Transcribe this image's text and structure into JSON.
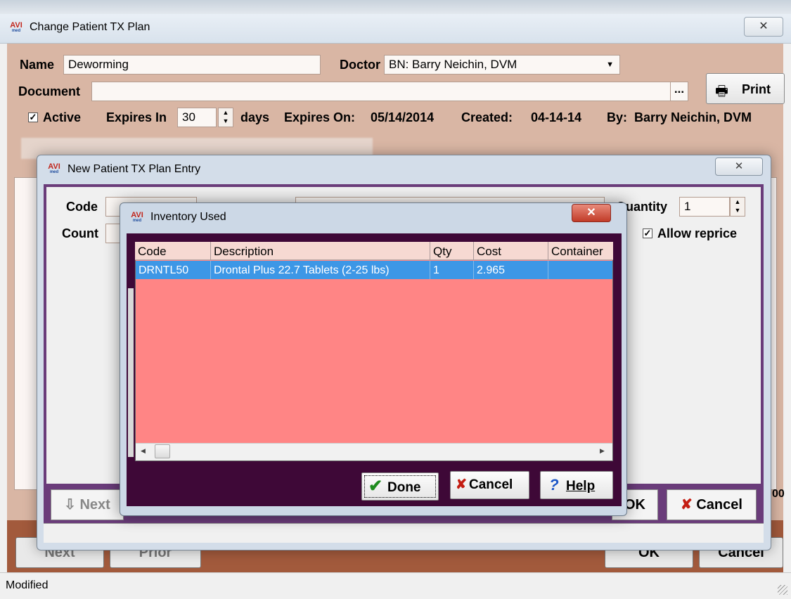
{
  "main": {
    "title": "Change Patient TX Plan",
    "logo_text": "AVI",
    "name_label": "Name",
    "name_value": "Deworming",
    "doctor_label": "Doctor",
    "doctor_value": "BN: Barry Neichin, DVM",
    "document_label": "Document",
    "document_value": "",
    "browse_label": "...",
    "print_label": "Print",
    "active_label": "Active",
    "expires_in_label": "Expires In",
    "expires_in_value": "30",
    "days_label": "days",
    "expires_on_label": "Expires On:",
    "expires_on_value": "05/14/2014",
    "created_label": "Created:",
    "created_value": "04-14-14",
    "by_label": "By:",
    "by_value": "Barry Neichin, DVM",
    "next_label": "Next",
    "prior_label": "Prior",
    "ok_label": "OK",
    "cancel_label": "Cancel",
    "status_text": "Modified"
  },
  "tx_entry": {
    "title": "New Patient TX Plan Entry",
    "code_label": "Code",
    "count_label": "Count",
    "quantity_label": "Quantity",
    "quantity_value": "1",
    "allow_reprice_label": "Allow reprice",
    "cancel_label": "Cancel",
    "value_right": "00"
  },
  "inventory": {
    "title": "Inventory Used",
    "columns": [
      "Code",
      "Description",
      "Qty",
      "Cost",
      "Container"
    ],
    "rows": [
      {
        "code": "DRNTL50",
        "description": "Drontal Plus 22.7 Tablets (2-25 lbs)",
        "qty": "1",
        "cost": "2.965",
        "container": ""
      }
    ],
    "done_label": "Done",
    "cancel_label": "Cancel",
    "help_label": "Help"
  },
  "colors": {
    "grid_fill": "#ff8585",
    "selected_row": "#3d97e6",
    "dialog_frame": "#3e0837",
    "main_body": "#d9b6a4"
  }
}
